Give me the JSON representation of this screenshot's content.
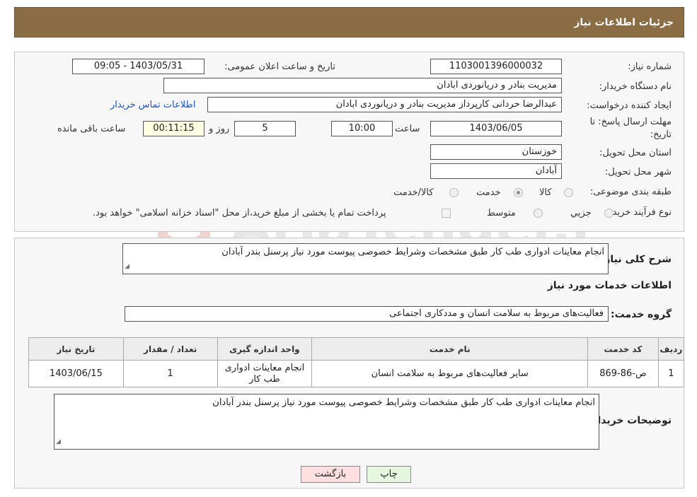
{
  "header": {
    "title": "جزئیات اطلاعات نیاز"
  },
  "fields": {
    "need_number_label": "شماره نیاز:",
    "need_number": "1103001396000032",
    "announce_label": "تاریخ و ساعت اعلان عمومی:",
    "announce_value": "1403/05/31 - 09:05",
    "buyer_org_label": "نام دستگاه خریدار:",
    "buyer_org": "مدیریت بنادر و دریانوردی ابادان",
    "creator_label": "ایجاد کننده درخواست:",
    "creator": "عبدالرضا حردانی کارپرداز مدیریت بنادر و دریانوردی ابادان",
    "contact_link": "اطلاعات تماس خریدار",
    "deadline_label_1": "مهلت ارسال پاسخ: تا",
    "deadline_label_2": "تاریخ:",
    "deadline_date": "1403/06/05",
    "time_label": "ساعت",
    "deadline_time": "10:00",
    "days_value": "5",
    "days_label": "روز و",
    "remaining_time": "00:11:15",
    "remaining_label": "ساعت باقی مانده",
    "province_label": "استان محل تحویل:",
    "province": "خوزستان",
    "city_label": "شهر محل تحویل:",
    "city": "آبادان",
    "category_label": "طبقه بندی موضوعی:",
    "category_options": [
      "کالا",
      "خدمت",
      "کالا/خدمت"
    ],
    "category_selected": "خدمت",
    "process_label": "نوع فرآیند خرید :",
    "process_options": [
      "جزیي",
      "متوسط"
    ],
    "payment_note": "پرداخت تمام یا بخشی از مبلغ خرید،از محل \"اسناد خزانه اسلامی\" خواهد بود."
  },
  "description": {
    "label": "شرح کلی نیاز:",
    "text": "انجام معاینات ادواری طب کار طبق مشخصات وشرایط خصوصی  پیوست مورد نیاز پرسنل بندر آبادان"
  },
  "services": {
    "section_title": "اطلاعات خدمات مورد نیاز",
    "group_label": "گروه خدمت:",
    "group_value": "فعالیت‌های مربوط به سلامت انسان و مددکاری اجتماعی",
    "columns": [
      "ردیف",
      "کد خدمت",
      "نام خدمت",
      "واحد اندازه گیری",
      "تعداد / مقدار",
      "تاریخ نیاز"
    ],
    "rows": [
      [
        "1",
        "ص-86-869",
        "سایر فعالیت‌های مربوط به سلامت انسان",
        "انجام معاینات ادواری طب کار",
        "1",
        "1403/06/15"
      ]
    ]
  },
  "buyer_notes": {
    "label": "توضیحات خریدار:",
    "text": "انجام معاینات ادواری طب کار طبق مشخصات وشرایط خصوصی  پیوست مورد نیاز پرسنل بندر آبادان"
  },
  "buttons": {
    "print": "چاپ",
    "back": "بازگشت"
  },
  "watermark": {
    "text": "AriaTender.neT"
  },
  "colors": {
    "header_bg": "#8a6d45",
    "link": "#1a55c4",
    "remaining_bg": "#ffffe3",
    "back_btn_bg": "#ffe0e0",
    "print_btn_bg": "#e6f7e0"
  }
}
